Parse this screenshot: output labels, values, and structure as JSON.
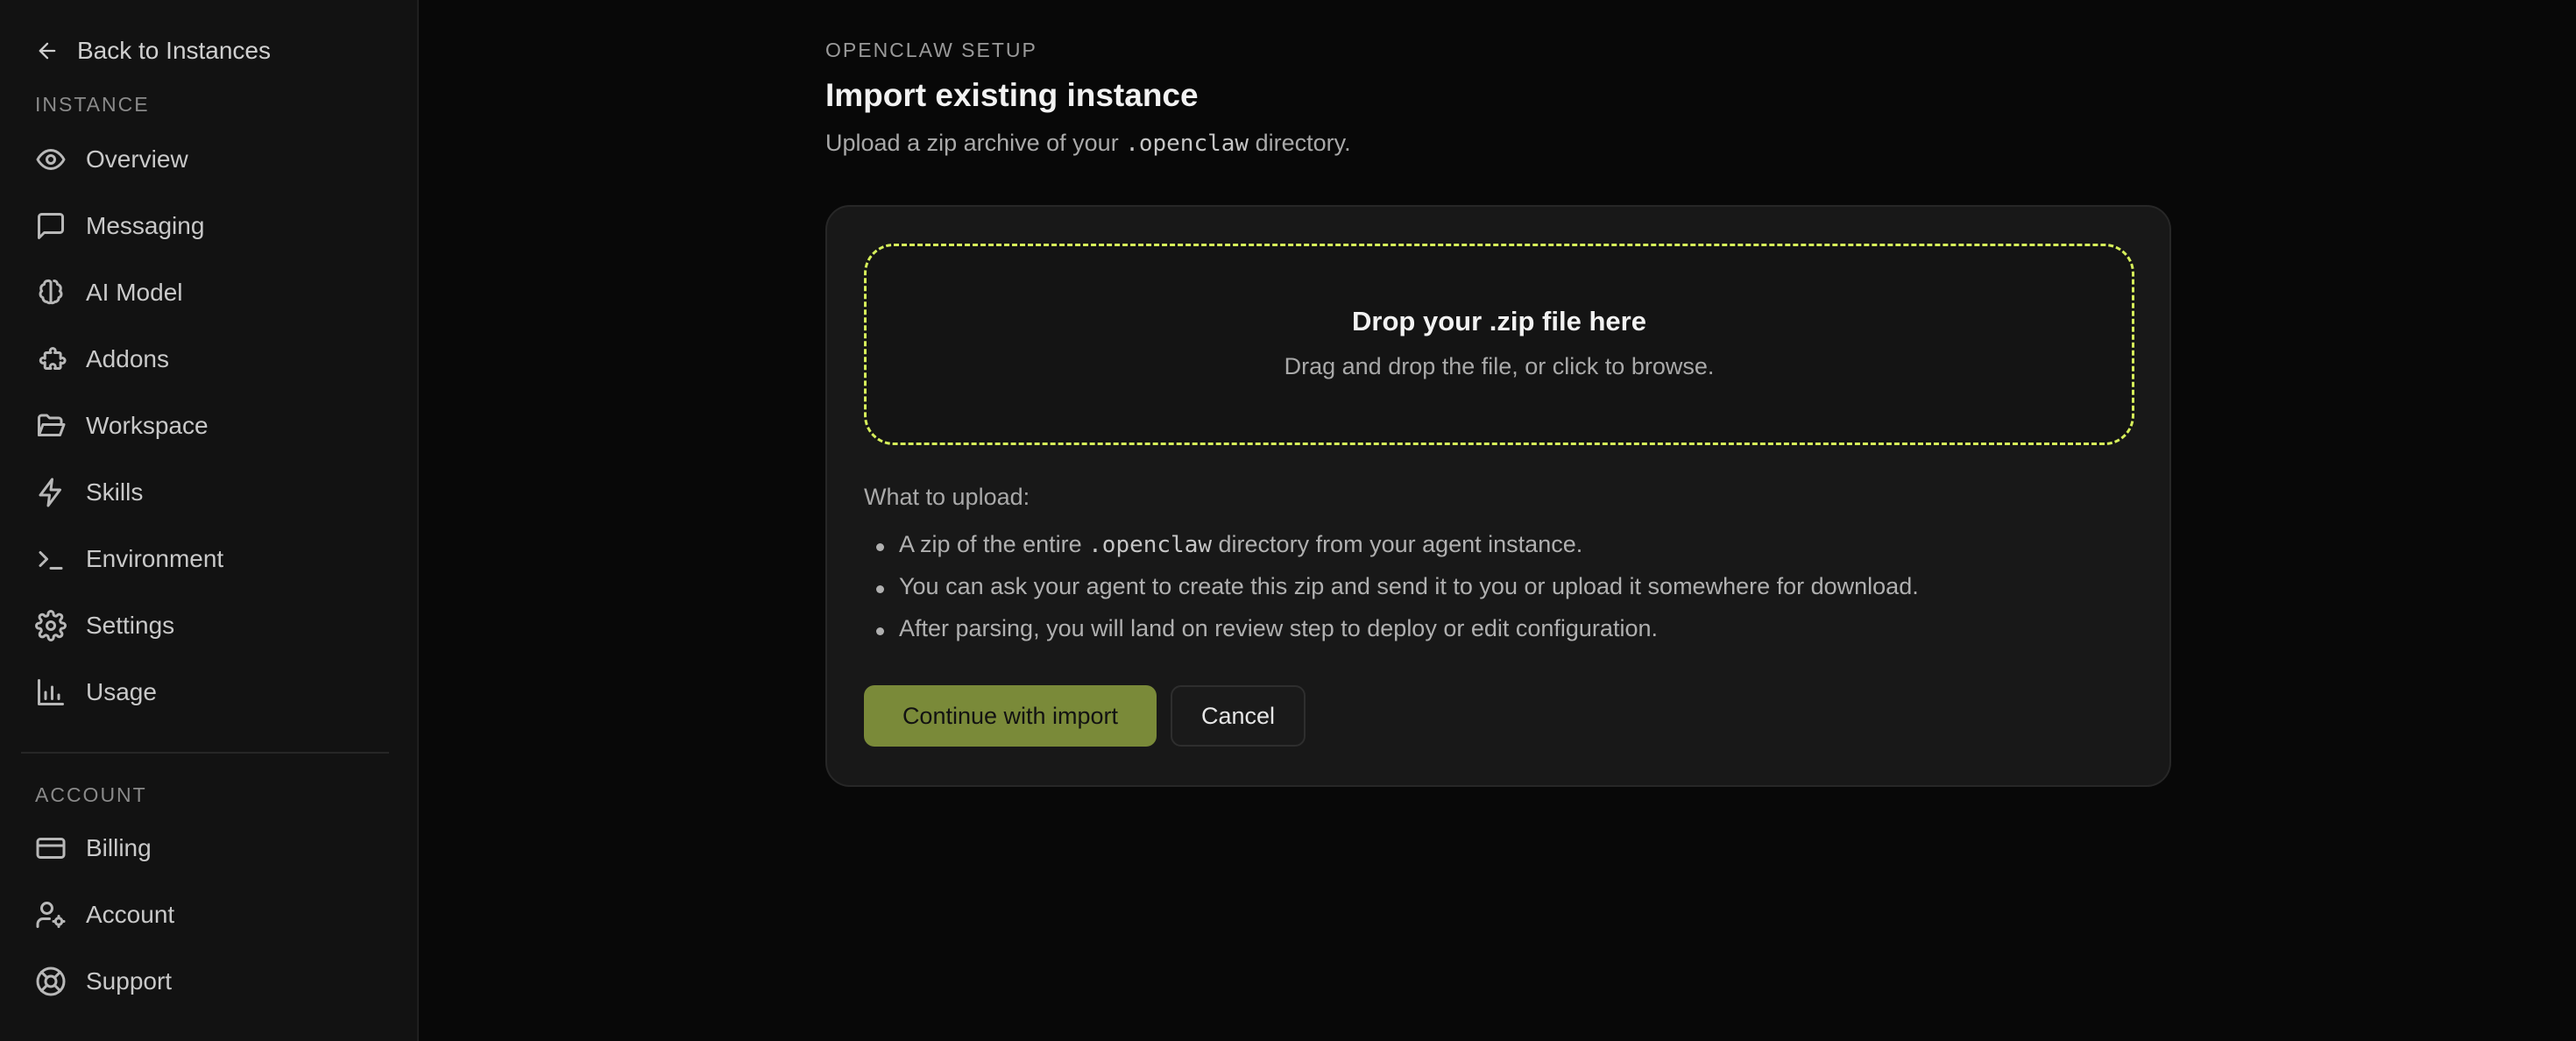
{
  "sidebar": {
    "back_label": "Back to Instances",
    "instance_section": "INSTANCE",
    "instance_items": [
      {
        "label": "Overview",
        "icon": "eye-icon"
      },
      {
        "label": "Messaging",
        "icon": "message-square-icon"
      },
      {
        "label": "AI Model",
        "icon": "brain-icon"
      },
      {
        "label": "Addons",
        "icon": "puzzle-icon"
      },
      {
        "label": "Workspace",
        "icon": "folder-open-icon"
      },
      {
        "label": "Skills",
        "icon": "lightning-icon"
      },
      {
        "label": "Environment",
        "icon": "terminal-icon"
      },
      {
        "label": "Settings",
        "icon": "gear-icon"
      },
      {
        "label": "Usage",
        "icon": "bar-chart-icon"
      }
    ],
    "account_section": "ACCOUNT",
    "account_items": [
      {
        "label": "Billing",
        "icon": "credit-card-icon"
      },
      {
        "label": "Account",
        "icon": "user-cog-icon"
      },
      {
        "label": "Support",
        "icon": "life-buoy-icon"
      }
    ]
  },
  "main": {
    "kicker": "OPENCLAW SETUP",
    "title": "Import existing instance",
    "subtitle_pre": "Upload a zip archive of your ",
    "subtitle_code": ".openclaw",
    "subtitle_post": " directory.",
    "dropzone": {
      "title": "Drop your .zip file here",
      "subtitle": "Drag and drop the file, or click to browse."
    },
    "upload_heading": "What to upload:",
    "bullets": {
      "b1_pre": "A zip of the entire ",
      "b1_code": ".openclaw",
      "b1_post": " directory from your agent instance.",
      "b2": "You can ask your agent to create this zip and send it to you or upload it somewhere for download.",
      "b3": "After parsing, you will land on review step to deploy or edit configuration."
    },
    "continue_label": "Continue with import",
    "cancel_label": "Cancel"
  },
  "colors": {
    "accent": "#d6ef5a",
    "primary_button": "#7a8a39",
    "background": "#080808",
    "sidebar_bg": "#121212",
    "card_bg": "#181818"
  }
}
